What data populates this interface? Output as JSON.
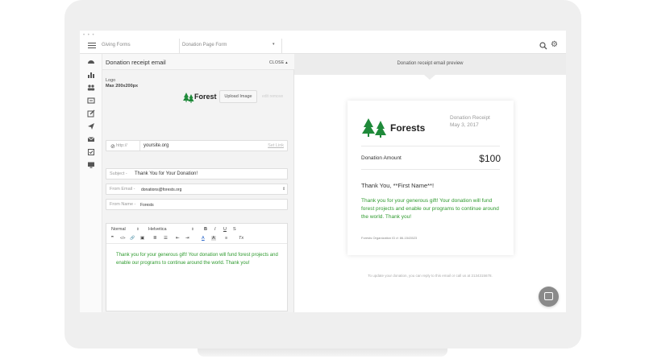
{
  "topbar": {
    "dots": "• • •",
    "title": "Giving Forms",
    "select_value": "Donation Page Form",
    "select_caret": "▾",
    "gear_glyph": "⚙"
  },
  "sidebar": {
    "icons": [
      "dashboard-icon",
      "chart-icon",
      "users-icon",
      "receipt-icon",
      "edit-icon",
      "send-icon",
      "mail-icon",
      "checklist-icon",
      "monitor-icon"
    ]
  },
  "panel": {
    "title": "Donation receipt email",
    "close_label": "CLOSE ▴",
    "logo_label": "Logo",
    "logo_size": "Max 200x200px",
    "logo_text": "Forest",
    "upload_label": "Upload Image",
    "faint_links": "edit  remove",
    "url_prefix": "http://",
    "url_value": "yoursite.org",
    "url_link": "Set Link",
    "subject_label": "Subject -",
    "subject_value": "Thank You for Your Donation!",
    "from_email_label": "From Email -",
    "from_email_value": "donations@forests.org",
    "from_email_caret": "⇕",
    "from_name_label": "From Name -",
    "from_name_value": "Forests",
    "editor": {
      "format": "Normal",
      "format_caret": "⇕",
      "font": "Helvetica",
      "font_caret": "⇕",
      "bold": "B",
      "italic": "I",
      "underline": "U",
      "strike": "S",
      "quote": "❞",
      "code": "</>",
      "link": "🔗",
      "image": "▣",
      "ol": "≣",
      "ul": "☰",
      "indent": "⇤",
      "outdent": "⇥",
      "color": "A",
      "highlight": "A",
      "align": "≡",
      "clear": "Tx",
      "body": "Thank you for your generous gift! Your donation will fund forest projects and enable our programs to continue around the world. Thank you!"
    }
  },
  "preview": {
    "header": "Donation receipt email preview",
    "logo_text": "Forests",
    "receipt_title": "Donation Receipt",
    "receipt_date": "May 3, 2017",
    "amount_label": "Donation Amount",
    "amount_value": "$100",
    "greeting": "Thank You, **First Name**!",
    "message": "Thank you for your generous gift! Your donation will fund forest projects and enable our programs to continue around the world. Thank you!",
    "org_footer": "Forests Organization ID #: 86-1543523",
    "footnote": "To update your donation, you can reply to this email or call us at 2134315678."
  },
  "colors": {
    "green_text": "#2e9a2e",
    "tree_green": "#1f8a3a",
    "frame": "#efefef"
  }
}
